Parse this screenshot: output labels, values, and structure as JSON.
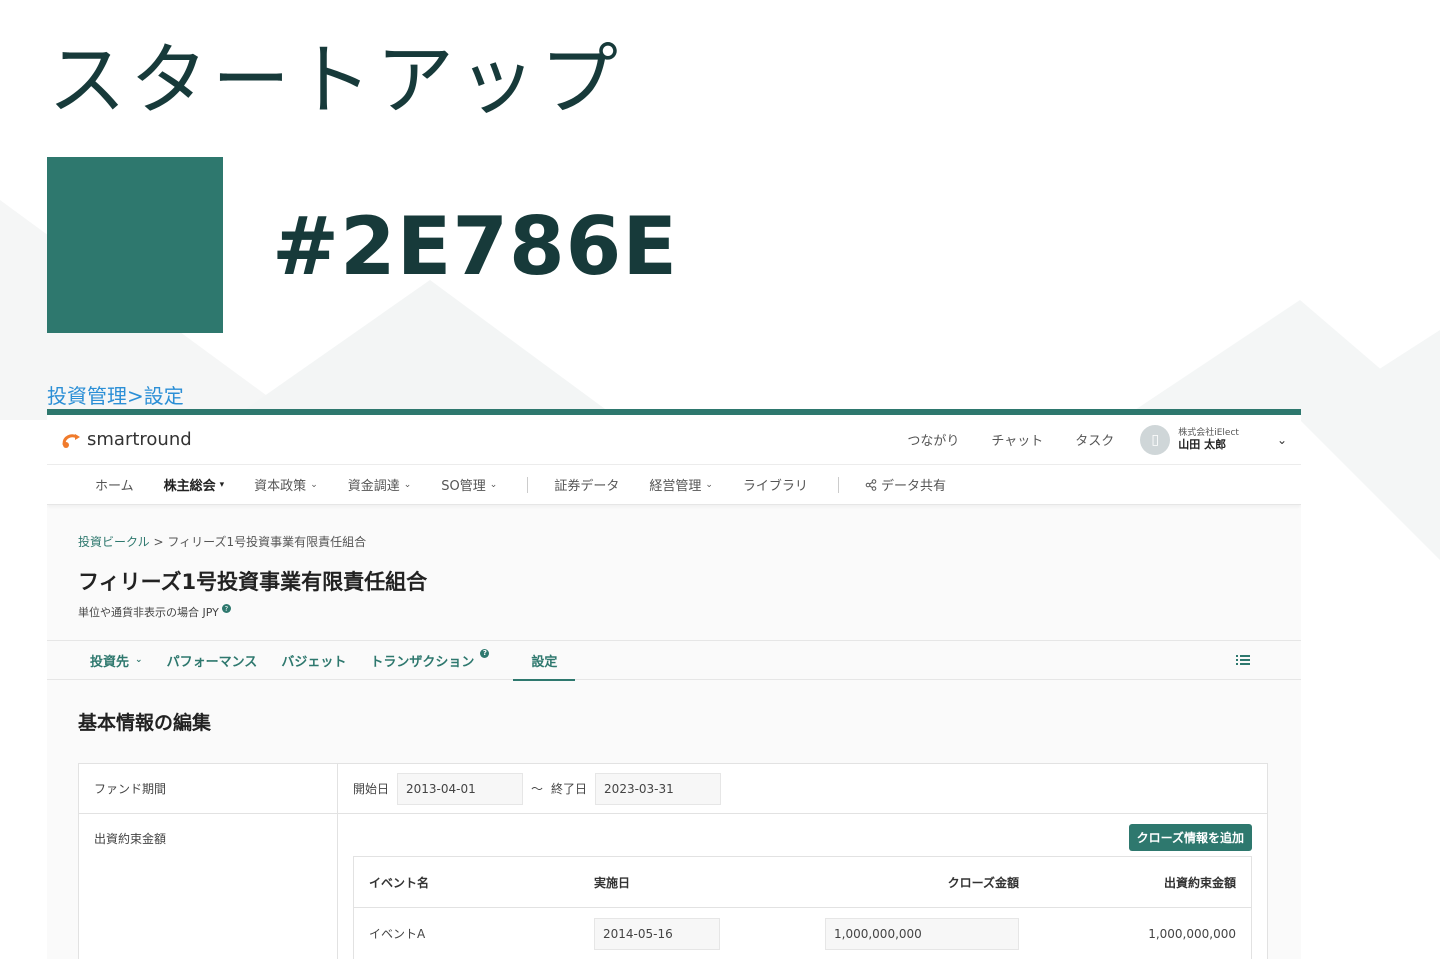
{
  "heading": "スタートアップ",
  "color": {
    "hex_label": "#2E786E",
    "value": "#2E786E"
  },
  "section_crumb": "投資管理>設定",
  "app": {
    "logo_text": "smartround",
    "header_links": [
      "つながり",
      "チャット",
      "タスク"
    ],
    "user": {
      "company": "株式会社iElect",
      "name": "山田 太郎"
    },
    "nav": [
      {
        "label": "ホーム",
        "caret": false,
        "bold": false
      },
      {
        "label": "株主総会",
        "caret": true,
        "bold": true
      },
      {
        "label": "資本政策",
        "caret": true,
        "bold": false
      },
      {
        "label": "資金調達",
        "caret": true,
        "bold": false
      },
      {
        "label": "SO管理",
        "caret": true,
        "bold": false
      },
      {
        "label": "証券データ",
        "caret": false,
        "bold": false
      },
      {
        "label": "経営管理",
        "caret": true,
        "bold": false
      },
      {
        "label": "ライブラリ",
        "caret": false,
        "bold": false
      },
      {
        "label": "データ共有",
        "caret": false,
        "bold": false
      }
    ],
    "breadcrumb": {
      "link": "投資ビークル",
      "current": " > フィリーズ1号投資事業有限責任組合"
    },
    "fund_title": "フィリーズ1号投資事業有限責任組合",
    "fund_sub": "単位や通貨非表示の場合 JPY",
    "tabs": [
      {
        "label": "投資先",
        "caret": true
      },
      {
        "label": "パフォーマンス"
      },
      {
        "label": "バジェット"
      },
      {
        "label": "トランザクション",
        "help": true
      },
      {
        "label": "設定",
        "active": true
      }
    ],
    "section_title": "基本情報の編集",
    "form": {
      "fund_period_label": "ファンド期間",
      "start_label": "開始日",
      "start_value": "2013-04-01",
      "tilde": "〜",
      "end_label": "終了日",
      "end_value": "2023-03-31",
      "commitment_label": "出資約束金額",
      "add_button": "クローズ情報を追加",
      "table": {
        "headers": [
          "イベント名",
          "実施日",
          "クローズ金額",
          "出資約束金額"
        ],
        "rows": [
          {
            "event": "イベントA",
            "date": "2014-05-16",
            "close_amount": "1,000,000,000",
            "commitment": "1,000,000,000"
          }
        ]
      }
    }
  }
}
